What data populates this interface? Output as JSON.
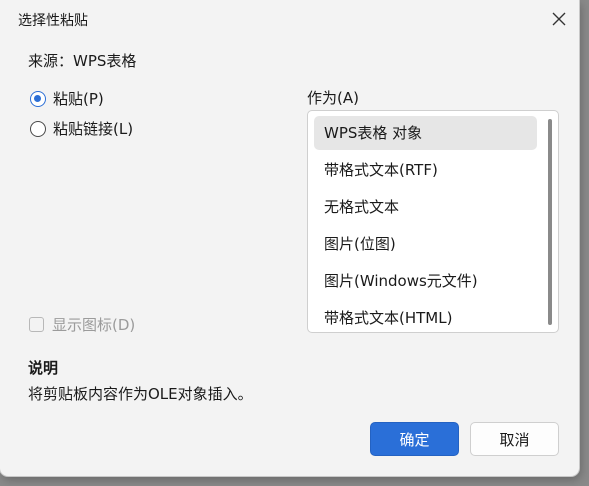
{
  "window": {
    "title": "选择性粘贴"
  },
  "source": {
    "label": "来源：WPS表格"
  },
  "paste_options": [
    {
      "label": "粘贴(P)",
      "selected": true
    },
    {
      "label": "粘贴链接(L)",
      "selected": false
    }
  ],
  "as_section": {
    "label": "作为(A)",
    "items": [
      {
        "label": "WPS表格 对象",
        "selected": true
      },
      {
        "label": "带格式文本(RTF)",
        "selected": false
      },
      {
        "label": "无格式文本",
        "selected": false
      },
      {
        "label": "图片(位图)",
        "selected": false
      },
      {
        "label": "图片(Windows元文件)",
        "selected": false
      },
      {
        "label": "带格式文本(HTML)",
        "selected": false
      }
    ]
  },
  "display_icon": {
    "label": "显示图标(D)",
    "checked": false,
    "enabled": false
  },
  "description": {
    "heading": "说明",
    "text": "将剪贴板内容作为OLE对象插入。"
  },
  "buttons": {
    "ok_label": "确定",
    "cancel_label": "取消"
  },
  "colors": {
    "accent": "#2a6fd8",
    "selected_item_bg": "#e6e6e6",
    "dialog_bg": "#f3f3f3"
  }
}
